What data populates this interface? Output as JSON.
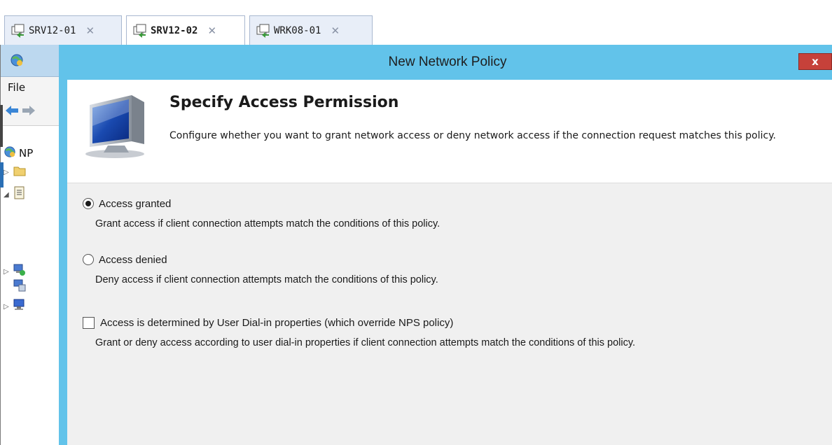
{
  "tabs": [
    {
      "label": "SRV12-01",
      "active": false
    },
    {
      "label": "SRV12-02",
      "active": true
    },
    {
      "label": "WRK08-01",
      "active": false
    }
  ],
  "mmc": {
    "menu_file": "File",
    "tree_root": "NP"
  },
  "dialog": {
    "title": "New Network Policy",
    "close_label": "x",
    "header": {
      "title": "Specify Access Permission",
      "description": "Configure whether you want to grant network access or deny network access if the connection request matches this policy."
    },
    "options": [
      {
        "type": "radio",
        "checked": true,
        "label": "Access granted",
        "description": "Grant access if client connection attempts match the conditions of this policy."
      },
      {
        "type": "radio",
        "checked": false,
        "label": "Access denied",
        "description": "Deny access if client connection attempts match the conditions of this policy."
      },
      {
        "type": "checkbox",
        "checked": false,
        "label": "Access is determined by User Dial-in properties (which override NPS policy)",
        "description": "Grant or deny access according to user dial-in properties if client connection attempts match the conditions of this policy."
      }
    ]
  },
  "colors": {
    "dialog_frame": "#62c3ea",
    "close_button": "#c6413a",
    "body_background": "#f0f0f0"
  }
}
